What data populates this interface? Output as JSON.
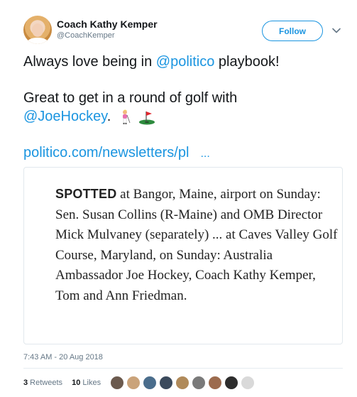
{
  "author": {
    "name": "Coach Kathy Kemper",
    "handle": "@CoachKemper",
    "follow_label": "Follow"
  },
  "tweet": {
    "line1_prefix": "Always love being in ",
    "line1_mention": "@politico",
    "line1_suffix": " playbook!",
    "line2": "Great to get in a round of golf with",
    "line3_mention": "@JoeHockey",
    "line3_suffix": ".",
    "emoji": [
      "golfer",
      "flag-in-hole"
    ],
    "link_text": "politico.com/newsletters/pl",
    "link_ellipsis": "..."
  },
  "card": {
    "lead": "SPOTTED",
    "body": " at Bangor, Maine, airport on Sunday: Sen. Susan Collins (R-Maine) and OMB Director Mick Mulvaney (separately) ... at Caves Valley Golf Course, Maryland, on Sunday: Australia Ambassador Joe Hockey, Coach Kathy Kemper, Tom and Ann Friedman."
  },
  "timestamp": "7:43 AM - 20 Aug 2018",
  "stats": {
    "retweets_count": "3",
    "retweets_label": " Retweets",
    "likes_count": "10",
    "likes_label": " Likes"
  },
  "likers_colors": [
    "#6b5a4e",
    "#caa37a",
    "#4a6d8c",
    "#3b4a5c",
    "#b08a5a",
    "#7a7a7a",
    "#9c6b4e",
    "#2d2d2d",
    "#d9d9d9"
  ],
  "colors": {
    "accent": "#1b95e0",
    "text": "#14171a",
    "muted": "#657786",
    "border": "#e1e8ed"
  }
}
